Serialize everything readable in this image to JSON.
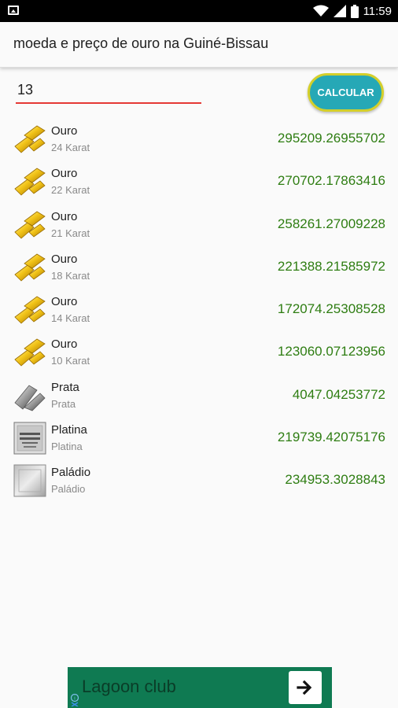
{
  "status_bar": {
    "time": "11:59",
    "icons": [
      "image-icon",
      "wifi-icon",
      "signal-icon",
      "battery-icon"
    ]
  },
  "toolbar": {
    "title": "moeda e preço de ouro na Guiné-Bissau"
  },
  "form": {
    "amount_value": "13",
    "calculate_label": "CALCULAR"
  },
  "colors": {
    "accent_teal": "#26a8b6",
    "button_border": "#d4cf2a",
    "input_underline": "#e53935",
    "value_green": "#2e7d12",
    "ad_background": "#0f7a52"
  },
  "metals": [
    {
      "name": "Ouro",
      "sub": "24 Karat",
      "value": "295209.26955702",
      "icon": "gold-bar-icon"
    },
    {
      "name": "Ouro",
      "sub": "22 Karat",
      "value": "270702.17863416",
      "icon": "gold-bar-icon"
    },
    {
      "name": "Ouro",
      "sub": "21 Karat",
      "value": "258261.27009228",
      "icon": "gold-bar-icon"
    },
    {
      "name": "Ouro",
      "sub": "18 Karat",
      "value": "221388.21585972",
      "icon": "gold-bar-icon"
    },
    {
      "name": "Ouro",
      "sub": "14 Karat",
      "value": "172074.25308528",
      "icon": "gold-bar-icon"
    },
    {
      "name": "Ouro",
      "sub": "10 Karat",
      "value": "123060.07123956",
      "icon": "gold-bar-icon"
    },
    {
      "name": "Prata",
      "sub": "Prata",
      "value": "4047.04253772",
      "icon": "silver-bar-icon"
    },
    {
      "name": "Platina",
      "sub": "Platina",
      "value": "219739.42075176",
      "icon": "platinum-bar-icon"
    },
    {
      "name": "Paládio",
      "sub": "Paládio",
      "value": "234953.3028843",
      "icon": "palladium-bar-icon"
    }
  ],
  "ad": {
    "text": "Lagoon club",
    "icons": [
      "ad-info-icon",
      "arrow-right-icon"
    ]
  }
}
